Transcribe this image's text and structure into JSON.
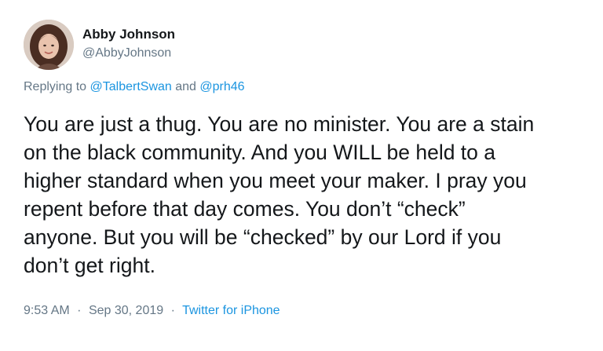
{
  "author": {
    "display_name": "Abby Johnson",
    "handle": "@AbbyJohnson",
    "avatar_icon": "profile-photo"
  },
  "reply": {
    "prefix": "Replying to",
    "mention_1": "@TalbertSwan",
    "conjunction": "and",
    "mention_2": "@prh46"
  },
  "tweet": {
    "lines": [
      "You are just a thug. You are no minister. You are a stain",
      "on the black community. And you WILL be held to a",
      "higher standard when you meet your maker. I pray you",
      "repent before that day comes. You don’t “check”",
      "anyone. But you will be “checked” by our Lord if you",
      "don’t get right."
    ]
  },
  "meta": {
    "time": "9:53 AM",
    "separator_1": "·",
    "date": "Sep 30, 2019",
    "separator_2": "·",
    "source": "Twitter for iPhone"
  },
  "colors": {
    "text": "#14171a",
    "secondary": "#657786",
    "link": "#1b95e0"
  }
}
